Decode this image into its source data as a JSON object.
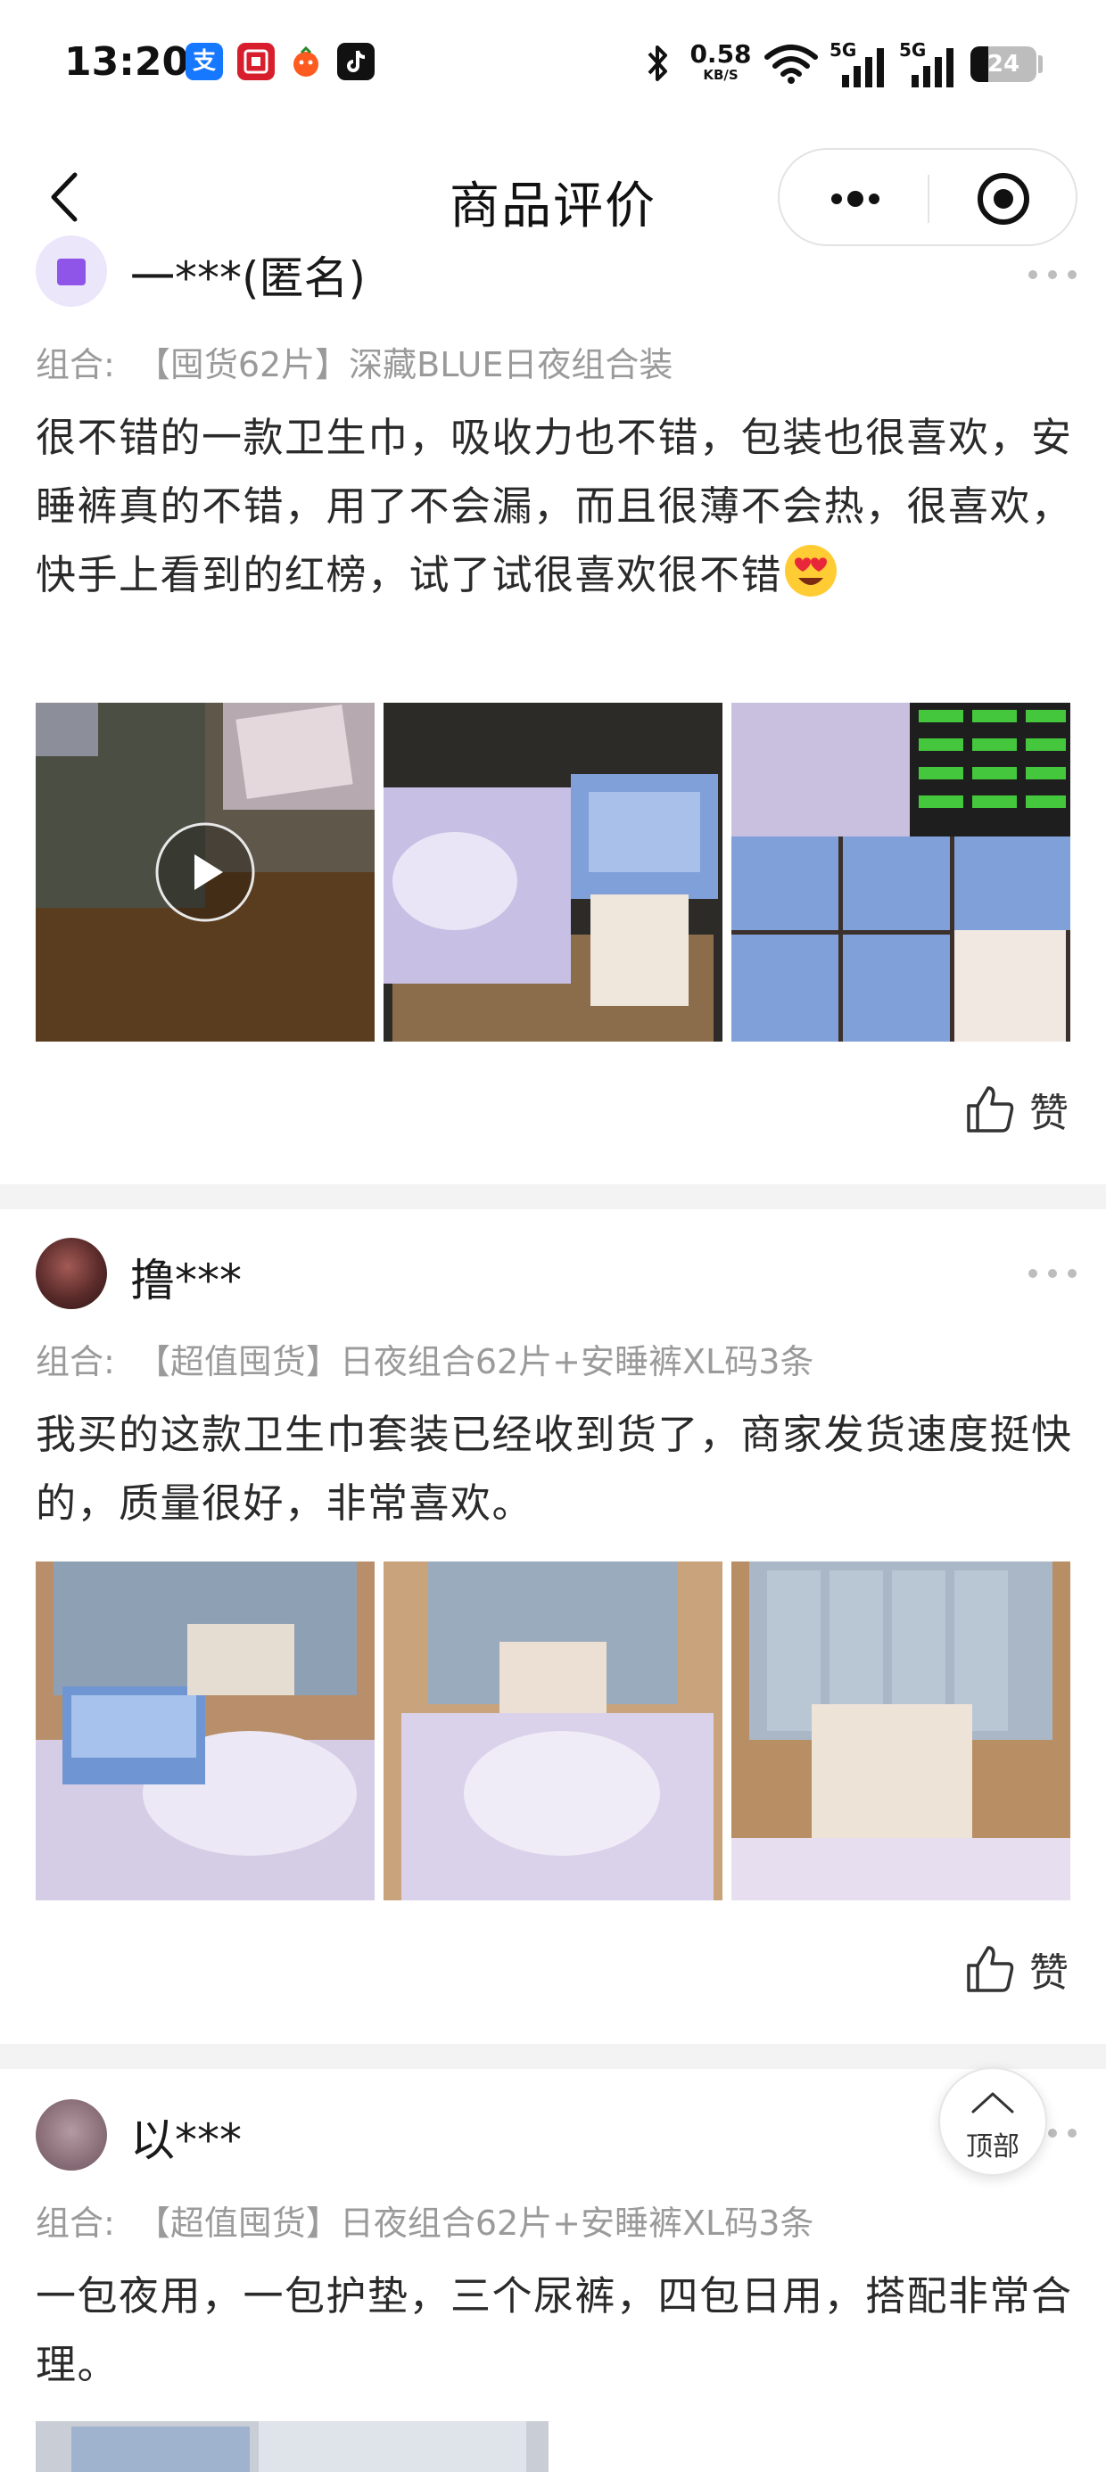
{
  "status_bar": {
    "time": "13:20",
    "net_speed_value": "0.58",
    "net_speed_unit": "KB/S",
    "signal_1": "5G",
    "signal_2": "5G",
    "battery": "24",
    "app_icons": [
      "alipay-icon",
      "bank-icon",
      "shop-icon",
      "douyin-icon"
    ]
  },
  "nav": {
    "title": "商品评价"
  },
  "reviews": [
    {
      "user": "一***(匿名)",
      "combo_label": "组合:",
      "combo_value": "【囤货62片】深藏BLUE日夜组合装",
      "content": "很不错的一款卫生巾，吸收力也不错，包装也很喜欢，安睡裤真的不错，用了不会漏，而且很薄不会热，很喜欢，快手上看到的红榜，试了试很喜欢很不错",
      "like_label": "赞"
    },
    {
      "user": "撸***",
      "combo_label": "组合:",
      "combo_value": "【超值囤货】日夜组合62片+安睡裤XL码3条",
      "content": "我买的这款卫生巾套装已经收到货了，商家发货速度挺快的，质量很好，非常喜欢。",
      "like_label": "赞"
    },
    {
      "user": "以***",
      "combo_label": "组合:",
      "combo_value": "【超值囤货】日夜组合62片+安睡裤XL码3条",
      "content": "一包夜用，一包护垫，三个尿裤，四包日用，搭配非常合理。"
    }
  ],
  "back_to_top": "顶部",
  "colors": {
    "text": "#1a1a1a",
    "muted": "#9a9a9a",
    "divider": "#f3f3f3",
    "pack_blue": "#7ea1d6",
    "pack_lilac": "#c9c2e6"
  }
}
